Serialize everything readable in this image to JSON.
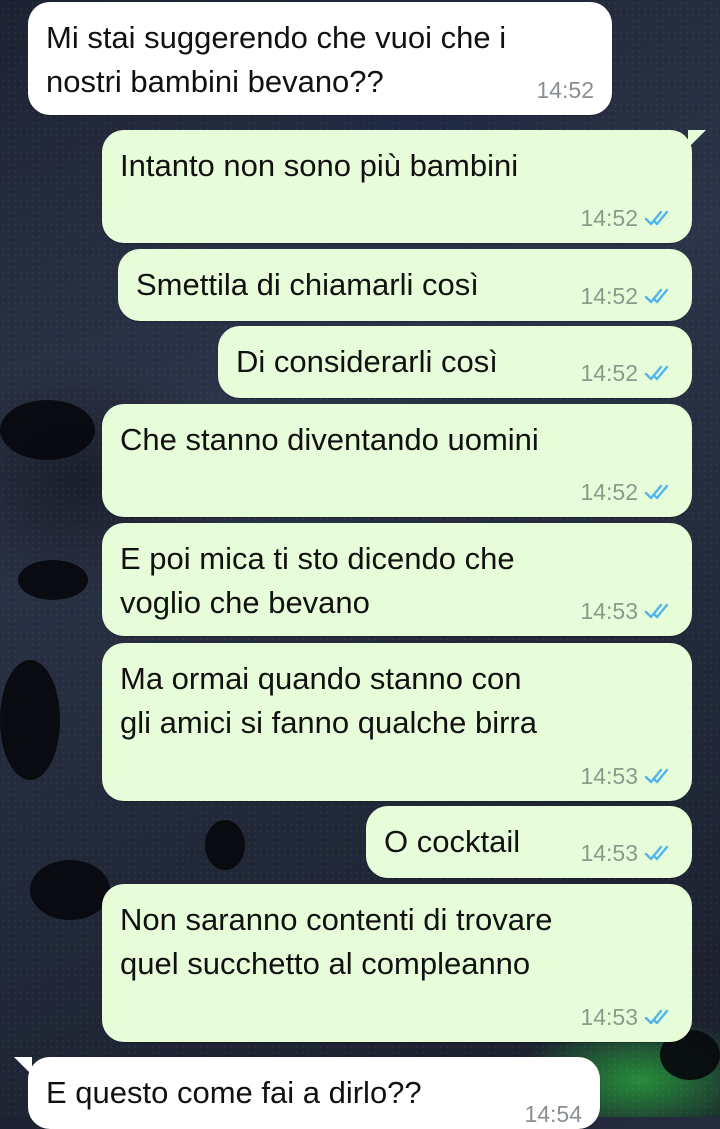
{
  "messages": [
    {
      "direction": "in",
      "text": "Mi stai suggerendo che vuoi che i\nnostri bambini bevano??",
      "time": "14:52"
    },
    {
      "direction": "out",
      "text": "Intanto non sono più bambini",
      "time": "14:52",
      "read": true
    },
    {
      "direction": "out",
      "text": "Smettila di chiamarli così",
      "time": "14:52",
      "read": true
    },
    {
      "direction": "out",
      "text": "Di considerarli così",
      "time": "14:52",
      "read": true
    },
    {
      "direction": "out",
      "text": "Che stanno diventando uomini",
      "time": "14:52",
      "read": true
    },
    {
      "direction": "out",
      "text": "E poi mica ti sto dicendo che\nvoglio che bevano",
      "time": "14:53",
      "read": true
    },
    {
      "direction": "out",
      "text": "Ma ormai quando stanno con\ngli amici si fanno qualche birra",
      "time": "14:53",
      "read": true
    },
    {
      "direction": "out",
      "text": "O cocktail",
      "time": "14:53",
      "read": true
    },
    {
      "direction": "out",
      "text": "Non saranno contenti di trovare\nquel succhetto al compleanno",
      "time": "14:53",
      "read": true
    },
    {
      "direction": "in",
      "text": "E questo come fai a dirlo??",
      "time": "14:54"
    }
  ],
  "colors": {
    "incoming_bubble": "#ffffff",
    "outgoing_bubble": "#e7fcd8",
    "read_check": "#4fb6ec"
  },
  "icons": {
    "read_receipt": "double-check-icon"
  }
}
